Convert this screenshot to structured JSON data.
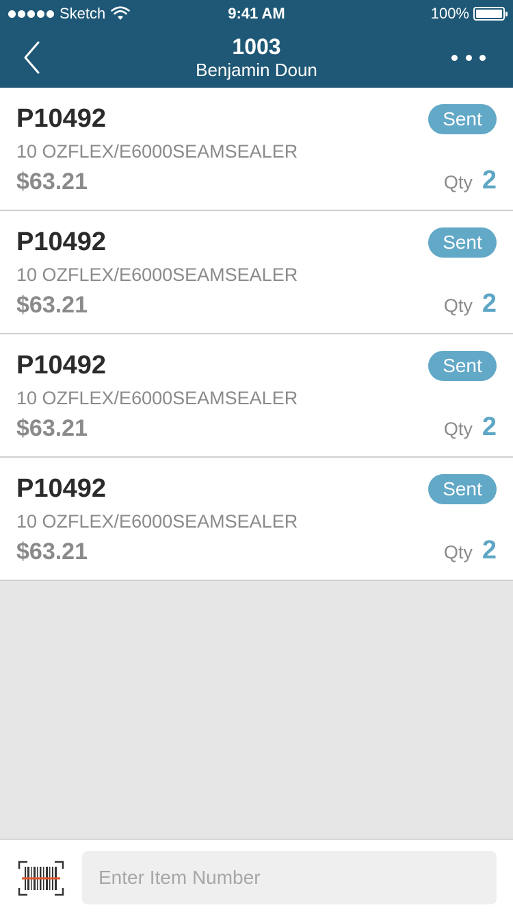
{
  "status_bar": {
    "carrier": "Sketch",
    "time": "9:41 AM",
    "battery": "100%"
  },
  "header": {
    "title": "1003",
    "subtitle": "Benjamin Doun",
    "back_icon": "chevron-left-icon",
    "more_icon": "more-horizontal-icon"
  },
  "items": [
    {
      "code": "P10492",
      "description": "10 OZFLEX/E6000SEAMSEALER",
      "price": "$63.21",
      "status": "Sent",
      "qty_label": "Qty",
      "qty": "2"
    },
    {
      "code": "P10492",
      "description": "10 OZFLEX/E6000SEAMSEALER",
      "price": "$63.21",
      "status": "Sent",
      "qty_label": "Qty",
      "qty": "2"
    },
    {
      "code": "P10492",
      "description": "10 OZFLEX/E6000SEAMSEALER",
      "price": "$63.21",
      "status": "Sent",
      "qty_label": "Qty",
      "qty": "2"
    },
    {
      "code": "P10492",
      "description": "10 OZFLEX/E6000SEAMSEALER",
      "price": "$63.21",
      "status": "Sent",
      "qty_label": "Qty",
      "qty": "2"
    }
  ],
  "bottom_bar": {
    "scan_icon": "barcode-scan-icon",
    "input_placeholder": "Enter Item Number",
    "input_value": ""
  },
  "colors": {
    "header_bg": "#1f5876",
    "badge_bg": "#62a8c7",
    "qty_accent": "#5ea6c5",
    "background": "#e6e6e6"
  }
}
